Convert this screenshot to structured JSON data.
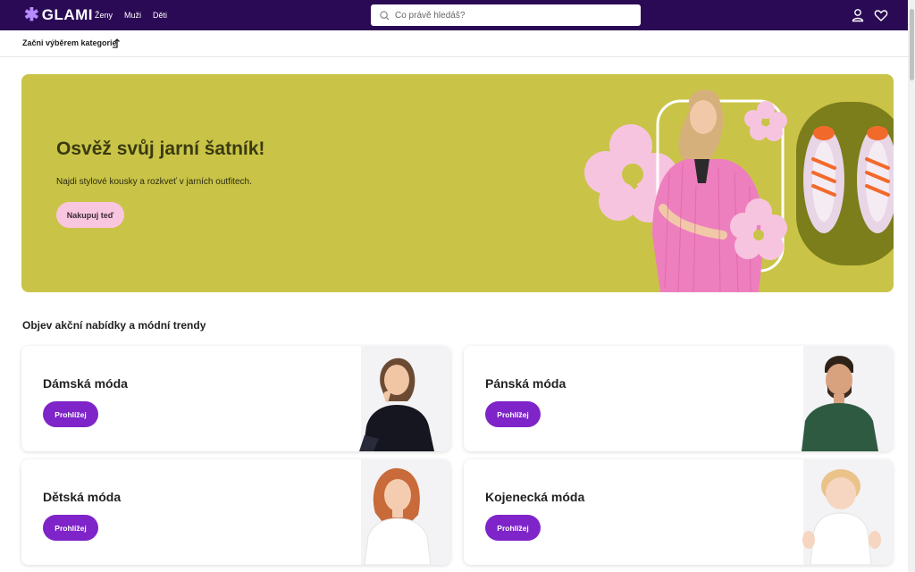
{
  "header": {
    "logo_text": "GLAMI",
    "nav": [
      "Ženy",
      "Muži",
      "Děti"
    ],
    "search_placeholder": "Co právě hledáš?",
    "icons": [
      "user-icon",
      "heart-icon"
    ]
  },
  "category_bar": {
    "label": "Začni výběrem kategorie"
  },
  "hero": {
    "title": "Osvěž svůj jarní šatník!",
    "subtitle": "Najdi stylové kousky a rozkveť v jarních outfitech.",
    "cta": "Nakupuj teď"
  },
  "section_title": "Objev akční nabídky a módní trendy",
  "cards": [
    {
      "title": "Dámská móda",
      "button": "Prohlížej"
    },
    {
      "title": "Pánská móda",
      "button": "Prohlížej"
    },
    {
      "title": "Dětská móda",
      "button": "Prohlížej"
    },
    {
      "title": "Kojenecká móda",
      "button": "Prohlížej"
    }
  ],
  "colors": {
    "topbar": "#2b0a55",
    "hero_bg": "#c9c447",
    "cta_pink": "#f9c6e0",
    "button_purple": "#7e24c8"
  }
}
